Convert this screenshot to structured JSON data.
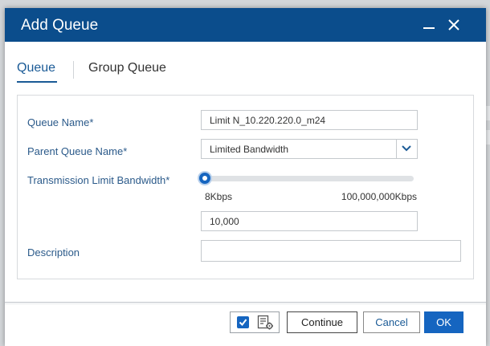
{
  "dialog": {
    "title": "Add Queue"
  },
  "tabs": [
    {
      "label": "Queue",
      "active": true
    },
    {
      "label": "Group Queue",
      "active": false
    }
  ],
  "form": {
    "queue_name": {
      "label": "Queue Name",
      "value": "Limit N_10.220.220.0_m24"
    },
    "parent_queue": {
      "label": "Parent Queue Name",
      "value": "Limited Bandwidth"
    },
    "bandwidth": {
      "label": "Transmission Limit Bandwidth",
      "min_label": "8Kbps",
      "max_label": "100,000,000Kbps",
      "value": "10,000",
      "slider_fraction": 0.0
    },
    "description": {
      "label": "Description",
      "value": ""
    },
    "required_marker": "*"
  },
  "footer": {
    "continue_label": "Continue",
    "cancel_label": "Cancel",
    "ok_label": "OK"
  },
  "colors": {
    "title_bar": "#0b4d8c",
    "accent": "#1565c0",
    "label": "#2b5a8a"
  }
}
